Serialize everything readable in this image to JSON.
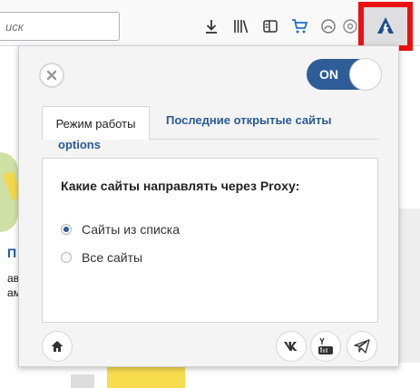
{
  "toolbar": {
    "search_placeholder": "иск",
    "icons": [
      "download-icon",
      "library-icon",
      "reader-icon",
      "cart-icon",
      "account-icon",
      "sync-icon",
      "overflow-icon",
      "extension-icon"
    ]
  },
  "background_page": {
    "letter": "П",
    "text1": "ав",
    "text2": "ам"
  },
  "popup": {
    "toggle_label": "ON",
    "tabs": [
      {
        "label": "Режим работы",
        "active": true
      },
      {
        "label": "Последние открытые сайты",
        "active": false
      },
      {
        "label": "options",
        "active": false
      }
    ],
    "question": "Какие сайты направлять через Proxy:",
    "options": [
      {
        "label": "Сайты из списка",
        "checked": true
      },
      {
        "label": "Все сайты",
        "checked": false
      }
    ],
    "footer_icons": [
      "home-icon",
      "vk-icon",
      "youtube-icon",
      "telegram-icon"
    ]
  },
  "colors": {
    "accent": "#2f5d97",
    "link": "#2a5a98",
    "highlight_box": "#ec1111"
  }
}
